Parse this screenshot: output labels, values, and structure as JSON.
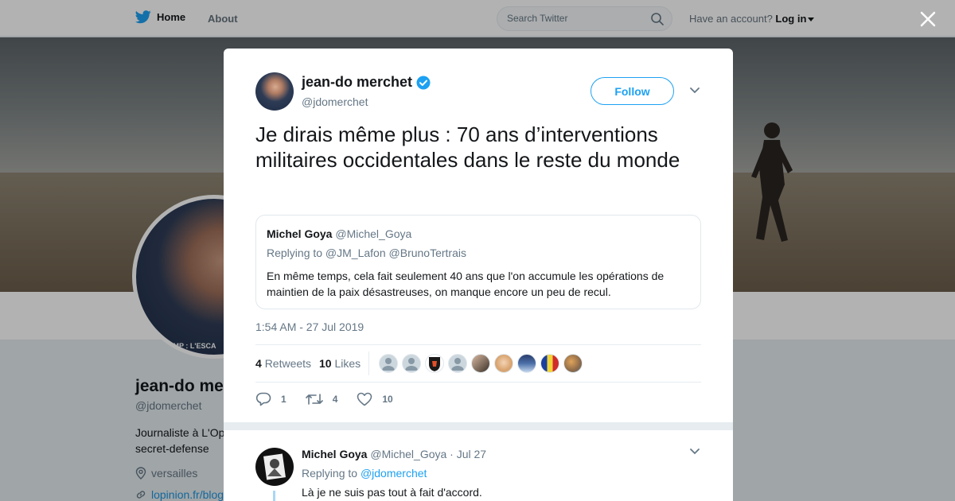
{
  "nav": {
    "home_label": "Home",
    "about_label": "About",
    "search_placeholder": "Search Twitter",
    "account_prompt": "Have an account?",
    "login_label": "Log in",
    "brand_color": "#1da1f2"
  },
  "profile": {
    "name": "jean-do me",
    "handle": "@jdomerchet",
    "bio": "Journaliste à L'Op secret-defense",
    "location": "versailles",
    "url": "lopinion.fr/blog",
    "avatar_ticker": "UMP : L'ESCA"
  },
  "tweet": {
    "author_name": "jean-do merchet",
    "author_handle": "@jdomerchet",
    "verified": true,
    "follow_label": "Follow",
    "text": "Je dirais même plus : 70 ans d’interventions militaires occidentales dans le reste du monde",
    "quote": {
      "name": "Michel Goya",
      "handle": "@Michel_Goya",
      "replying_to": "Replying to @JM_Lafon @BrunoTertrais",
      "text": "En même temps, cela fait seulement 40 ans que l'on accumule les opérations de maintien de la paix désastreuses, on manque encore un peu de recul."
    },
    "timestamp": "1:54 AM - 27 Jul 2019",
    "retweets_count": "4",
    "retweets_label": "Retweets",
    "likes_count": "10",
    "likes_label": "Likes",
    "actions": {
      "reply_count": "1",
      "retweet_count": "4",
      "like_count": "10"
    }
  },
  "reply": {
    "name": "Michel Goya",
    "meta": "@Michel_Goya · Jul 27",
    "replying_prefix": "Replying to",
    "replying_handle": "@jdomerchet",
    "text": "Là je ne suis pas tout à fait d'accord."
  }
}
